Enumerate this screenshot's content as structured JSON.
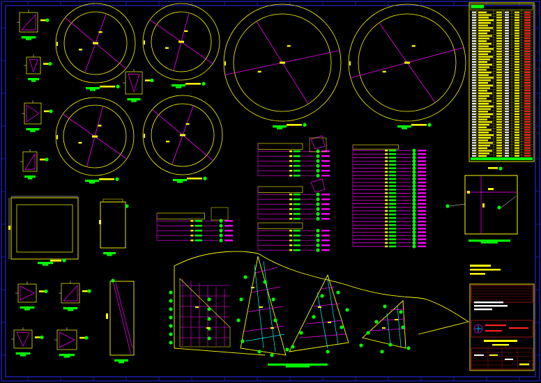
{
  "sheet": {
    "background": "#000000",
    "colors": {
      "frame": "#2b2bff",
      "outline": "#ffff00",
      "member": "#ff00ff",
      "bolt": "#00ff00",
      "dim": "#ffffff",
      "cyan": "#00ffff",
      "red": "#ff2020",
      "tag": "#ffff00"
    }
  },
  "title_block": {
    "line1": "",
    "line2": "",
    "line3": ""
  }
}
